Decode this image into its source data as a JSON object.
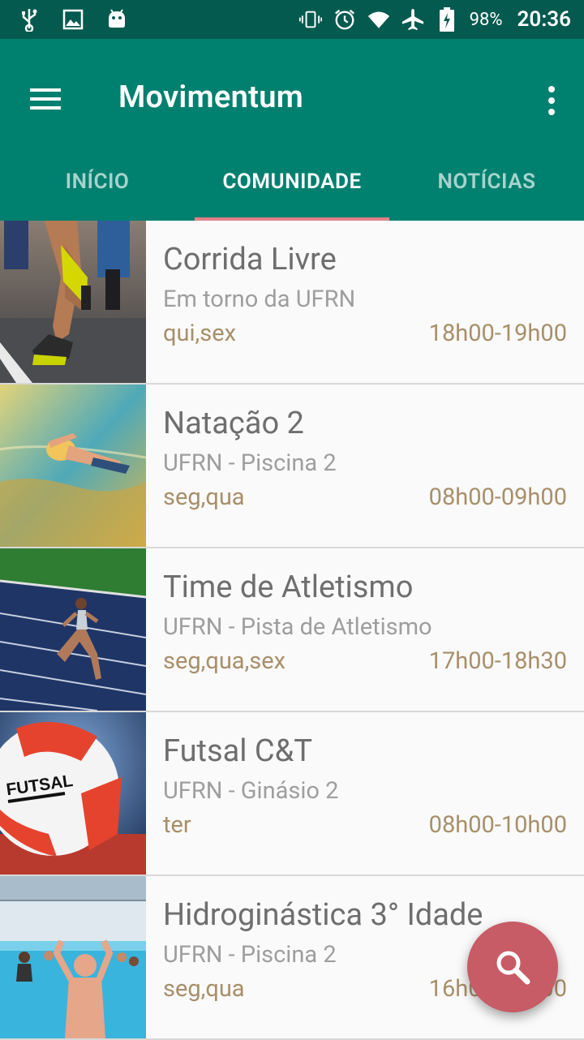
{
  "status_bar": {
    "icons_left": [
      "usb-icon",
      "image-icon",
      "android-icon"
    ],
    "icons_right": [
      "vibrate-icon",
      "alarm-icon",
      "wifi-icon",
      "airplane-icon",
      "battery-charging-icon"
    ],
    "battery": "98%",
    "time": "20:36"
  },
  "app_bar": {
    "title": "Movimentum",
    "menu_icon": "hamburger-menu-icon",
    "overflow_icon": "more-vert-icon",
    "color": "#00806f"
  },
  "tabs": [
    {
      "label": "INÍCIO",
      "active": false
    },
    {
      "label": "COMUNIDADE",
      "active": true
    },
    {
      "label": "NOTÍCIAS",
      "active": false
    }
  ],
  "activities": [
    {
      "title": "Corrida Livre",
      "place": "Em torno da UFRN",
      "days": "qui,sex",
      "time": "18h00-19h00",
      "image": "running-photo"
    },
    {
      "title": "Natação 2",
      "place": "UFRN - Piscina 2",
      "days": "seg,qua",
      "time": "08h00-09h00",
      "image": "swimming-photo"
    },
    {
      "title": "Time de Atletismo",
      "place": "UFRN - Pista de Atletismo",
      "days": "seg,qua,sex",
      "time": "17h00-18h30",
      "image": "track-athlete-photo"
    },
    {
      "title": "Futsal C&T",
      "place": "UFRN - Ginásio 2",
      "days": "ter",
      "time": "08h00-10h00",
      "image": "futsal-ball-photo"
    },
    {
      "title": "Hidroginástica 3° Idade",
      "place": "UFRN - Piscina 2",
      "days": "seg,qua",
      "time": "16h00-17h00",
      "image": "water-aerobics-photo"
    }
  ],
  "fab": {
    "icon": "search-icon",
    "color": "#c75b66"
  },
  "colors": {
    "accent": "#e07f89",
    "schedule_text": "#a88f6a",
    "status_bar": "#045a4f"
  }
}
